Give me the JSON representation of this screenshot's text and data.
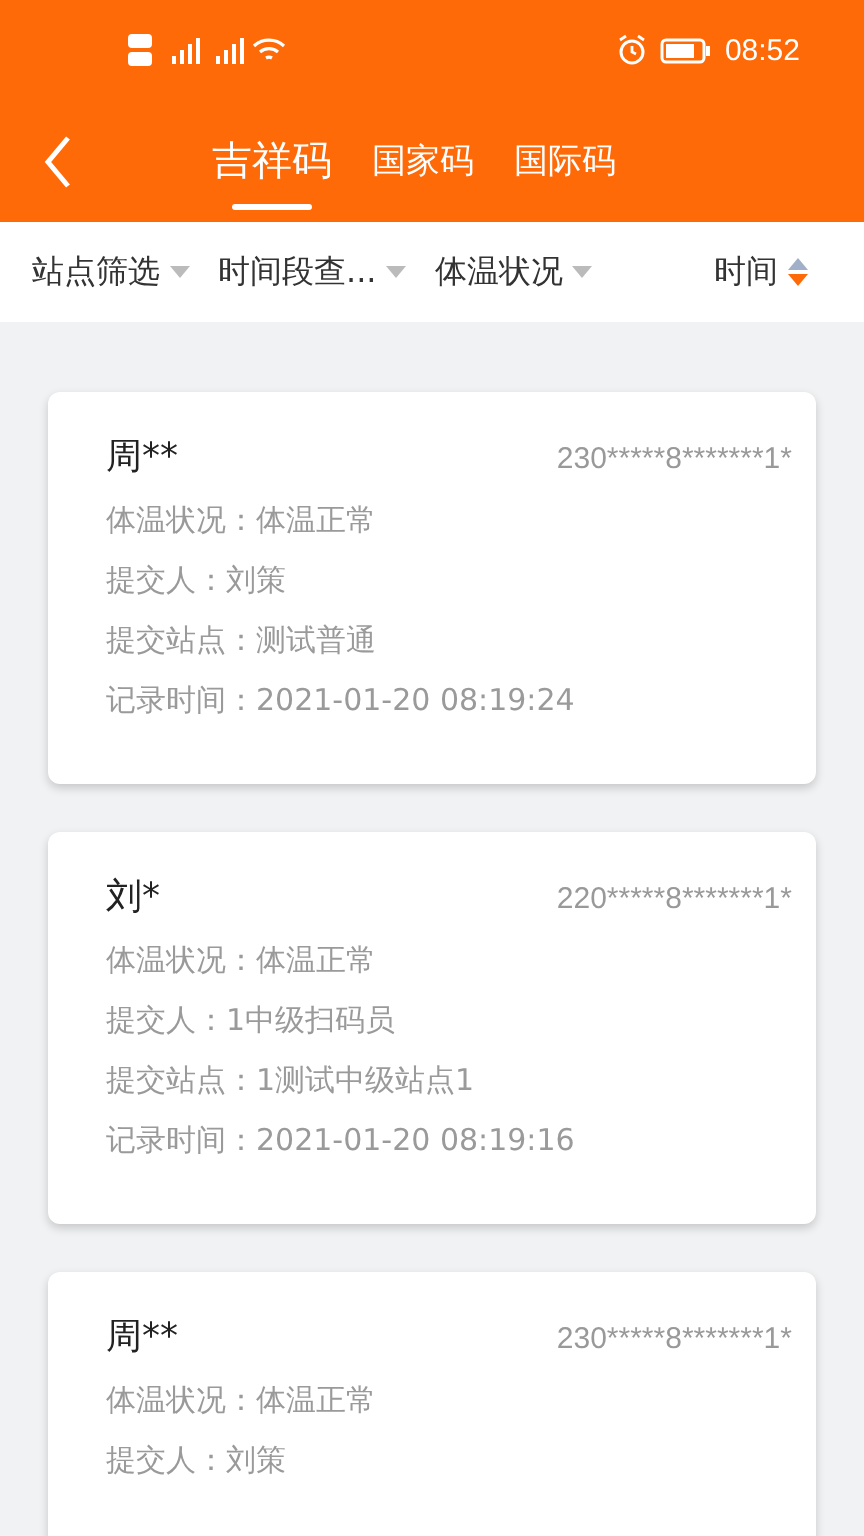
{
  "status_bar": {
    "time": "08:52"
  },
  "tabs": [
    {
      "label": "吉祥码",
      "selected": true
    },
    {
      "label": "国家码",
      "selected": false
    },
    {
      "label": "国际码",
      "selected": false
    }
  ],
  "filters": [
    {
      "label": "站点筛选",
      "kind": "dropdown"
    },
    {
      "label": "时间段查...",
      "kind": "dropdown"
    },
    {
      "label": "体温状况",
      "kind": "dropdown"
    },
    {
      "label": "时间",
      "kind": "sort",
      "descending": true
    }
  ],
  "records": [
    {
      "name": "周**",
      "id": "230*****8*******1*",
      "fields": [
        "体温状况：体温正常",
        "提交人：刘策",
        "提交站点：测试普通",
        "记录时间：2021-01-20 08:19:24"
      ]
    },
    {
      "name": "刘*",
      "id": "220*****8*******1*",
      "fields": [
        "体温状况：体温正常",
        "提交人：1中级扫码员",
        "提交站点：1测试中级站点1",
        "记录时间：2021-01-20 08:19:16"
      ]
    },
    {
      "name": "周**",
      "id": "230*****8*******1*",
      "fields": [
        "体温状况：体温正常",
        "提交人：刘策"
      ]
    }
  ]
}
